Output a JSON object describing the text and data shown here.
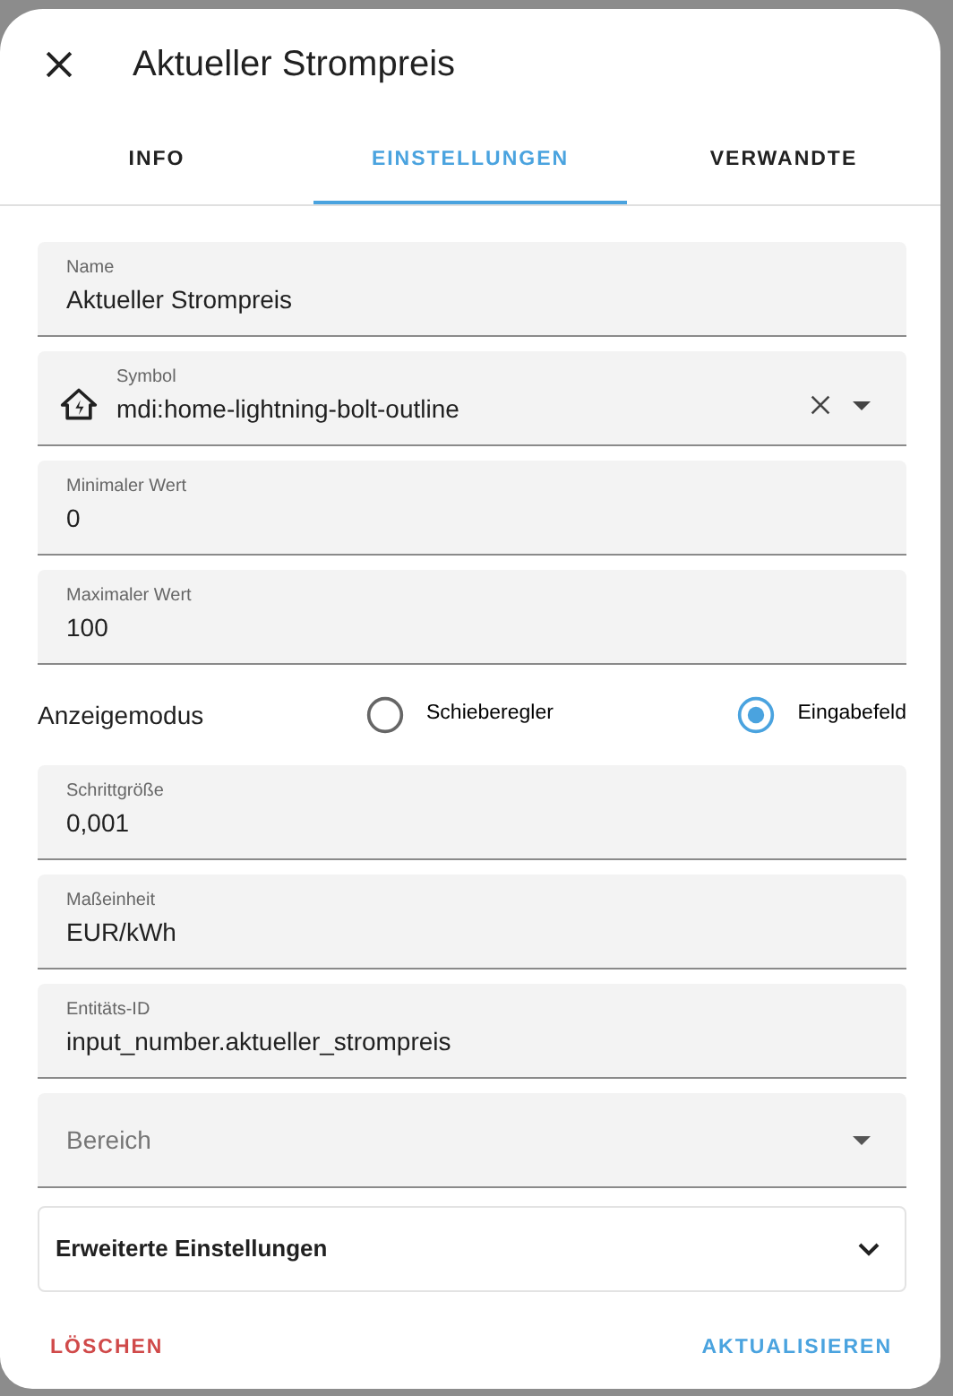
{
  "dialog": {
    "title": "Aktueller Strompreis"
  },
  "tabs": [
    {
      "label": "INFO",
      "selected": false
    },
    {
      "label": "EINSTELLUNGEN",
      "selected": true
    },
    {
      "label": "VERWANDTE",
      "selected": false
    }
  ],
  "fields_top": [
    {
      "kind": "text",
      "label": "Name",
      "value": "Aktueller Strompreis"
    },
    {
      "kind": "icon",
      "label": "Symbol",
      "value": "mdi:home-lightning-bolt-outline"
    },
    {
      "kind": "text",
      "label": "Minimaler Wert",
      "value": "0"
    },
    {
      "kind": "text",
      "label": "Maximaler Wert",
      "value": "100"
    }
  ],
  "display_mode": {
    "label": "Anzeigemodus",
    "options": [
      {
        "label": "Schieberegler",
        "selected": false
      },
      {
        "label": "Eingabefeld",
        "selected": true
      }
    ]
  },
  "fields_bottom": [
    {
      "kind": "text",
      "label": "Schrittgröße",
      "value": "0,001"
    },
    {
      "kind": "text",
      "label": "Maßeinheit",
      "value": "EUR/kWh"
    },
    {
      "kind": "text",
      "label": "Entitäts-ID",
      "value": "input_number.aktueller_strompreis"
    },
    {
      "kind": "select",
      "placeholder": "Bereich"
    }
  ],
  "advanced": {
    "label": "Erweiterte Einstellungen",
    "expanded": false
  },
  "buttons": [
    {
      "label": "LÖSCHEN",
      "kind": "danger"
    },
    {
      "label": "AKTUALISIEREN",
      "kind": "primary"
    }
  ]
}
